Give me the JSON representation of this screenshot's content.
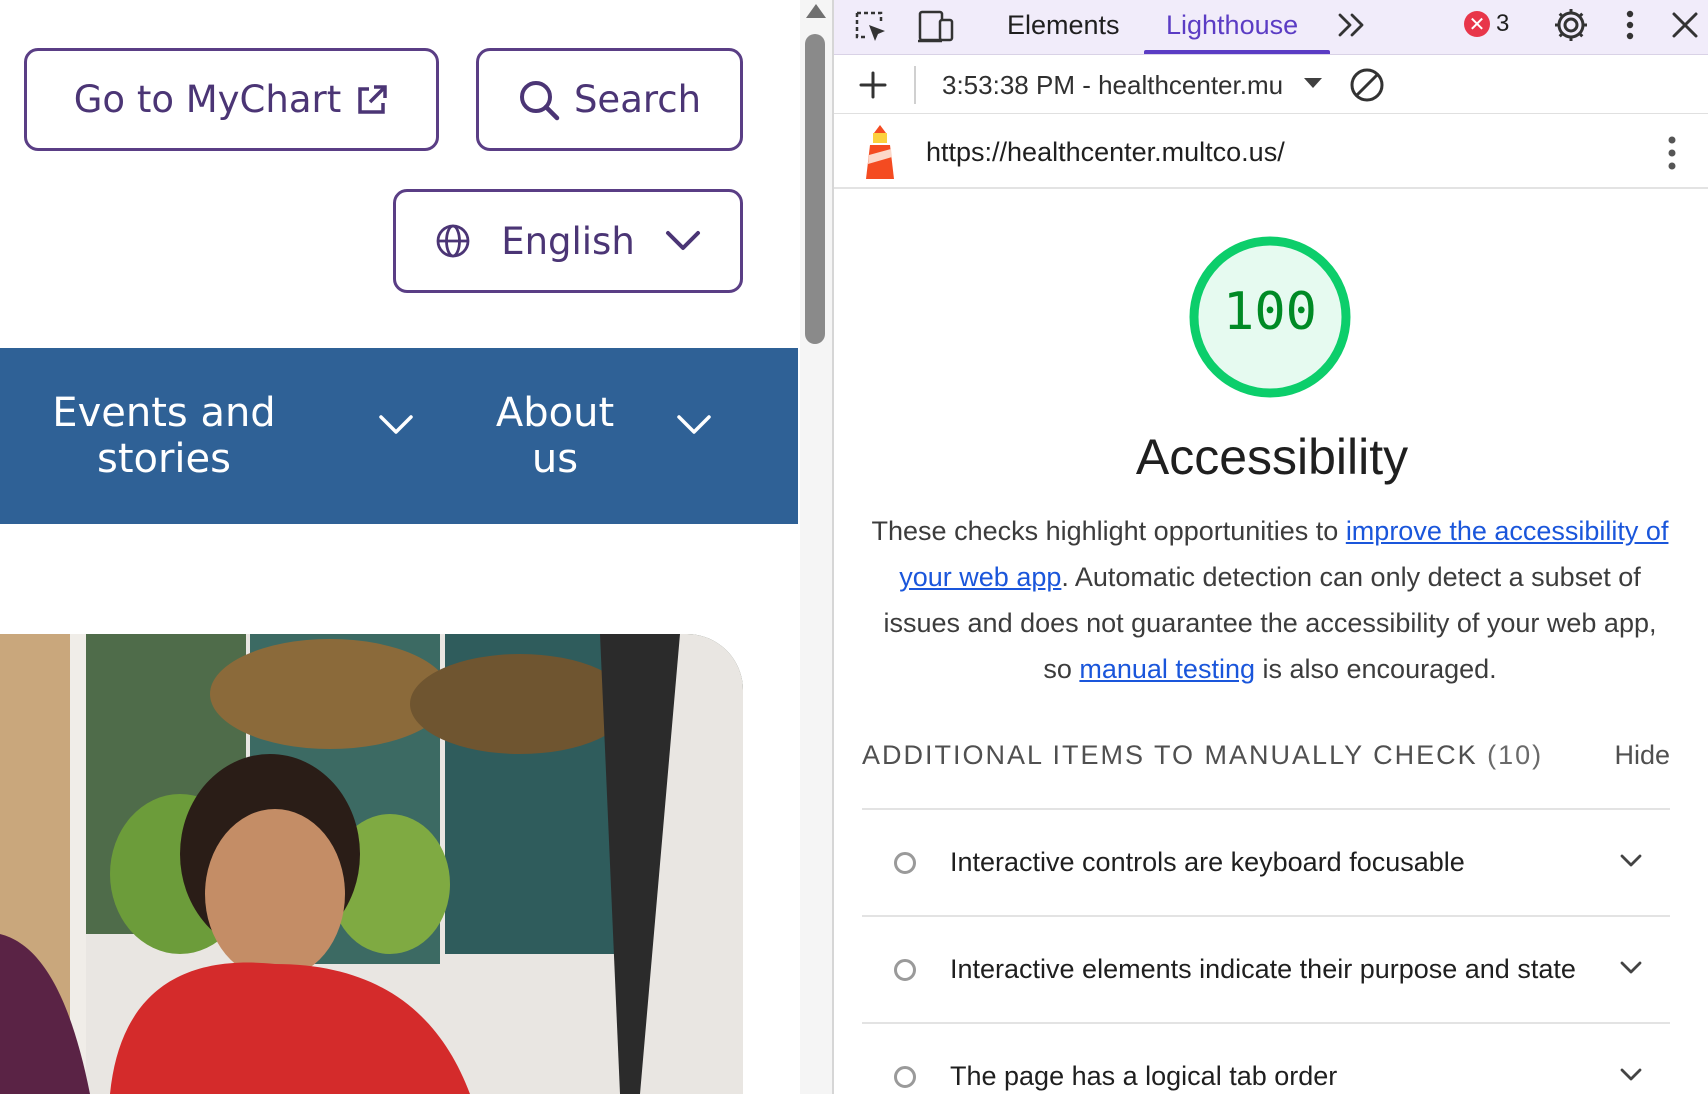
{
  "site": {
    "mychart_label": "Go to MyChart",
    "search_label": "Search",
    "language_label": "English",
    "nav": [
      {
        "label": "Events and stories"
      },
      {
        "label": "About us"
      }
    ],
    "brand_color": "#4b3575",
    "nav_color": "#2f6196"
  },
  "devtools": {
    "tabs": [
      {
        "label": "Elements"
      },
      {
        "label": "Lighthouse"
      }
    ],
    "active_tab": "Lighthouse",
    "error_count": "3",
    "error_symbol": "✕",
    "report_label": "3:53:38 PM - healthcenter.mu",
    "report_url": "https://healthcenter.multco.us/"
  },
  "lighthouse": {
    "score": "100",
    "score_fraction": 1.0,
    "score_color": "#0cce6b",
    "category": "Accessibility",
    "desc_part1": "These checks highlight opportunities to ",
    "desc_link1": "improve the accessibility of your web app",
    "desc_part2": ". Automatic detection can only detect a subset of issues and does not guarantee the accessibility of your web app, so ",
    "desc_link2": "manual testing",
    "desc_part3": " is also encouraged.",
    "manual_title": "ADDITIONAL ITEMS TO MANUALLY CHECK",
    "manual_count": "(10)",
    "hide_label": "Hide",
    "audits": [
      {
        "title": "Interactive controls are keyboard focusable"
      },
      {
        "title": "Interactive elements indicate their purpose and state"
      },
      {
        "title": "The page has a logical tab order"
      }
    ]
  }
}
